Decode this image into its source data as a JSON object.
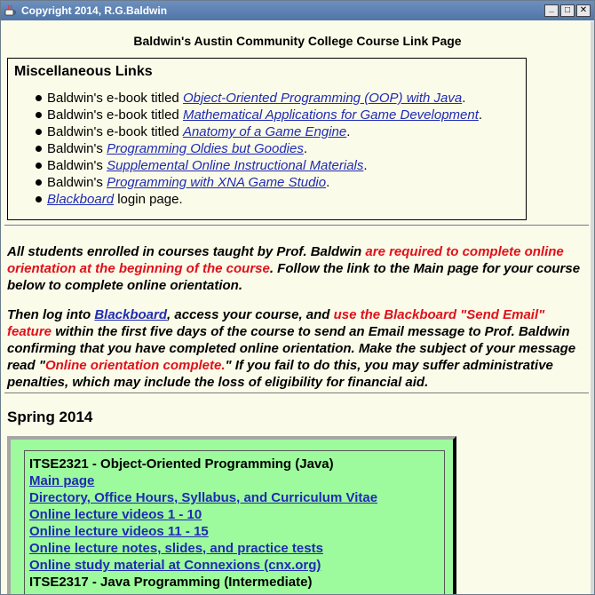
{
  "window": {
    "title": "Copyright 2014, R.G.Baldwin",
    "controls": {
      "minimize": "_",
      "maximize": "□",
      "close": "✕"
    }
  },
  "page": {
    "heading": "Baldwin's Austin Community College Course Link Page",
    "misc": {
      "title": "Miscellaneous Links",
      "items": [
        {
          "prefix": "Baldwin's e-book titled ",
          "link": "Object-Oriented Programming (OOP) with Java",
          "suffix": "."
        },
        {
          "prefix": "Baldwin's e-book titled ",
          "link": "Mathematical Applications for Game Development",
          "suffix": "."
        },
        {
          "prefix": "Baldwin's e-book titled ",
          "link": "Anatomy of a Game Engine",
          "suffix": "."
        },
        {
          "prefix": "Baldwin's ",
          "link": "Programming Oldies but Goodies",
          "suffix": "."
        },
        {
          "prefix": "Baldwin's ",
          "link": "Supplemental Online Instructional Materials",
          "suffix": "."
        },
        {
          "prefix": "Baldwin's ",
          "link": "Programming with XNA Game Studio",
          "suffix": "."
        },
        {
          "prefix": "",
          "link": "Blackboard",
          "suffix": " login page."
        }
      ]
    },
    "notice1": {
      "part1": "All students enrolled in courses taught by Prof. Baldwin ",
      "red1": "are required to complete online orientation at the beginning of the course",
      "part2": ".  Follow the link to the Main page for your course below to complete online orientation."
    },
    "notice2": {
      "part1": "Then log into ",
      "link": "Blackboard",
      "part2": ", access your course, and ",
      "red1": "use the Blackboard \"Send Email\" feature",
      "part3": " within the first five days of the course to send an Email message to Prof. Baldwin confirming that you have completed online orientation. Make the subject of your message read \"",
      "red2": "Online orientation complete.",
      "part4": "\" If you fail to do this, you may suffer administrative penalties, which may include the loss of eligibility for financial aid."
    },
    "semester": "Spring 2014",
    "course": {
      "title": "ITSE2321 - Object-Oriented Programming (Java)",
      "links": [
        "Main page",
        "Directory, Office Hours, Syllabus, and Curriculum Vitae",
        "Online lecture videos 1 - 10",
        "Online lecture videos 11 - 15",
        "Online lecture notes, slides, and practice tests",
        "Online study material at Connexions (cnx.org)"
      ],
      "next_title": "ITSE2317 - Java Programming (Intermediate)"
    }
  }
}
